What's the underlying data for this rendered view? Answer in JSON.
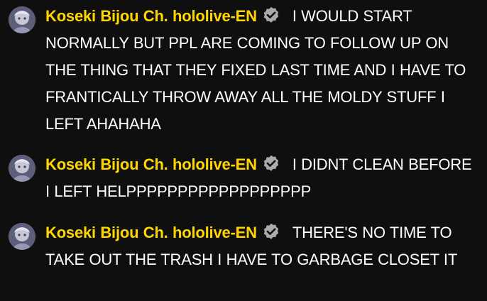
{
  "messages": [
    {
      "author": "Koseki Bijou Ch. hololive-EN",
      "avatar_icon": "avatar-bijou",
      "badge_icon": "verified-badge-icon",
      "text": "I WOULD START NORMALLY BUT PPL ARE COMING TO FOLLOW UP ON THE THING THAT THEY FIXED LAST TIME AND I HAVE TO FRANTICALLY THROW AWAY ALL THE MOLDY STUFF I LEFT AHAHAHA"
    },
    {
      "author": "Koseki Bijou Ch. hololive-EN",
      "avatar_icon": "avatar-bijou",
      "badge_icon": "verified-badge-icon",
      "text": "I DIDNT CLEAN BEFORE I LEFT HELPPPPPPPPPPPPPPPPPP"
    },
    {
      "author": "Koseki Bijou Ch. hololive-EN",
      "avatar_icon": "avatar-bijou",
      "badge_icon": "verified-badge-icon",
      "text": "THERE'S NO TIME TO TAKE OUT THE TRASH I HAVE TO GARBAGE CLOSET IT"
    }
  ],
  "colors": {
    "background": "#0f0f0f",
    "author": "#ffd600",
    "message_text": "#ffffff",
    "badge": "#aaaaaa"
  }
}
